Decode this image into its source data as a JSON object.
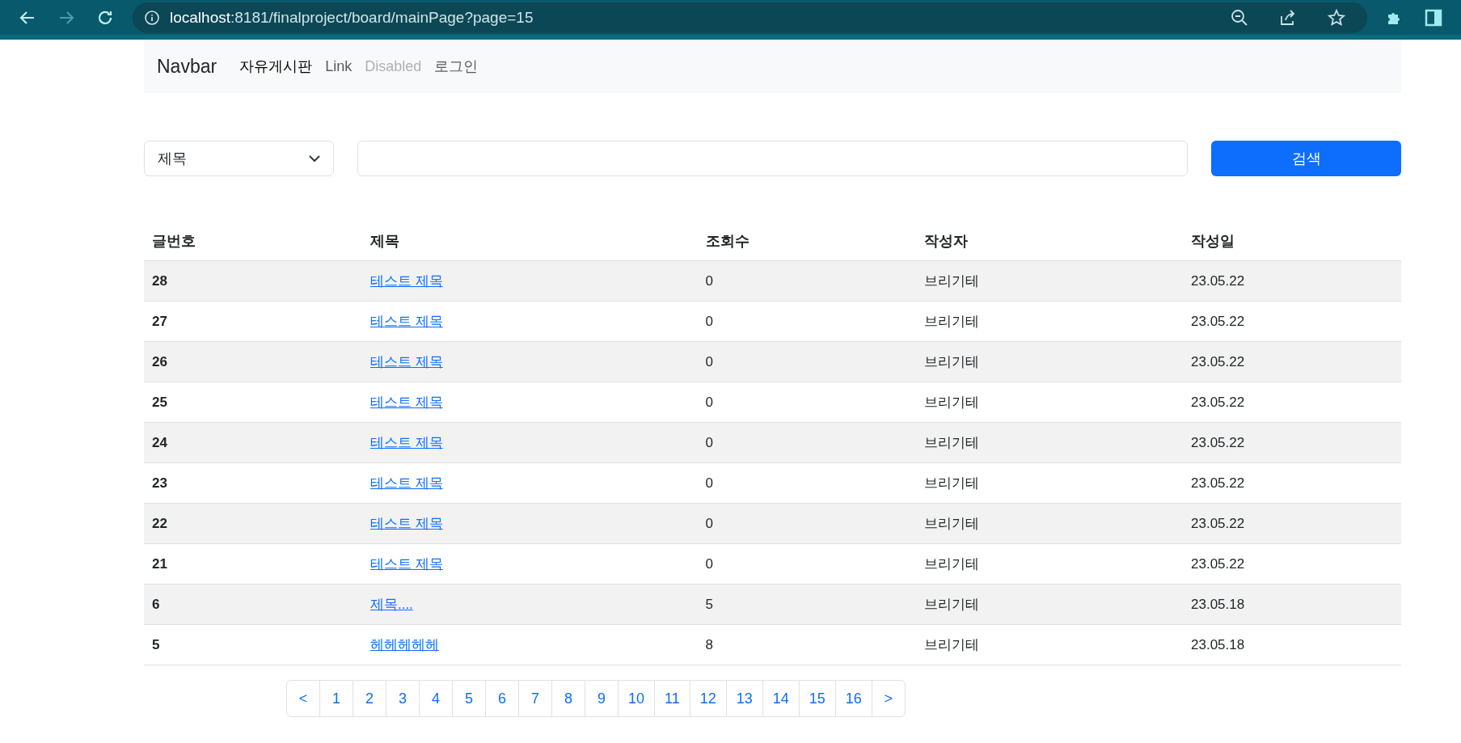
{
  "browser": {
    "url_host": "localhost",
    "url_path": ":8181/finalproject/board/mainPage?page=15"
  },
  "navbar": {
    "brand": "Navbar",
    "links": [
      {
        "label": "자유게시판",
        "disabled": false,
        "active": true
      },
      {
        "label": "Link",
        "disabled": false,
        "active": false
      },
      {
        "label": "Disabled",
        "disabled": true,
        "active": false
      },
      {
        "label": "로그인",
        "disabled": false,
        "active": false
      }
    ]
  },
  "search": {
    "select_value": "제목",
    "button": "검색"
  },
  "table": {
    "columns": [
      "글번호",
      "제목",
      "조회수",
      "작성자",
      "작성일"
    ],
    "rows": [
      {
        "no": "28",
        "title": "테스트 제목",
        "views": "0",
        "author": "브리기테",
        "date": "23.05.22"
      },
      {
        "no": "27",
        "title": "테스트 제목",
        "views": "0",
        "author": "브리기테",
        "date": "23.05.22"
      },
      {
        "no": "26",
        "title": "테스트 제목",
        "views": "0",
        "author": "브리기테",
        "date": "23.05.22"
      },
      {
        "no": "25",
        "title": "테스트 제목",
        "views": "0",
        "author": "브리기테",
        "date": "23.05.22"
      },
      {
        "no": "24",
        "title": "테스트 제목",
        "views": "0",
        "author": "브리기테",
        "date": "23.05.22"
      },
      {
        "no": "23",
        "title": "테스트 제목",
        "views": "0",
        "author": "브리기테",
        "date": "23.05.22"
      },
      {
        "no": "22",
        "title": "테스트 제목",
        "views": "0",
        "author": "브리기테",
        "date": "23.05.22"
      },
      {
        "no": "21",
        "title": "테스트 제목",
        "views": "0",
        "author": "브리기테",
        "date": "23.05.22"
      },
      {
        "no": "6",
        "title": "제목....",
        "views": "5",
        "author": "브리기테",
        "date": "23.05.18"
      },
      {
        "no": "5",
        "title": "헤헤헤헤헤",
        "views": "8",
        "author": "브리기테",
        "date": "23.05.18"
      }
    ]
  },
  "pagination": [
    "<",
    "1",
    "2",
    "3",
    "4",
    "5",
    "6",
    "7",
    "8",
    "9",
    "10",
    "11",
    "12",
    "13",
    "14",
    "15",
    "16",
    ">"
  ]
}
